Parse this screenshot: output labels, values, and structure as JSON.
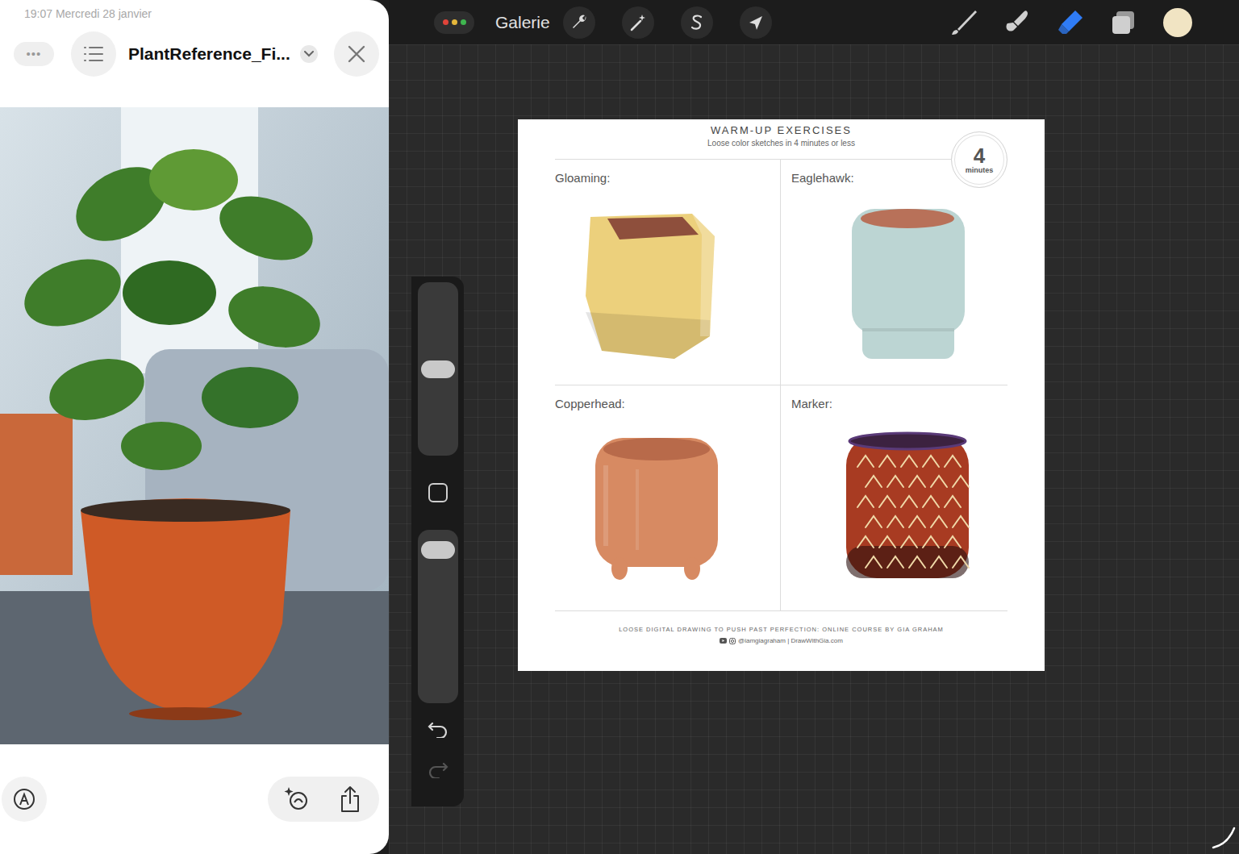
{
  "status_bar": {
    "time_date": "19:07 Mercredi 28 janvier"
  },
  "quick_look": {
    "more": "•••",
    "title": "PlantReference_Fi..."
  },
  "toolbar": {
    "gallery": "Galerie",
    "tools": [
      {
        "kind": "brush",
        "selected": false
      },
      {
        "kind": "smudge",
        "selected": false
      },
      {
        "kind": "eraser",
        "selected": true
      },
      {
        "kind": "layers",
        "selected": false
      }
    ],
    "current_color": "#f1e4c3"
  },
  "sidebar": {
    "sliders": [
      {
        "kind": "size",
        "level": 0.5
      },
      {
        "kind": "opacity",
        "level": 0.93
      }
    ],
    "undo": {
      "disabled": false
    },
    "redo": {
      "disabled": true
    }
  },
  "canvas": {
    "title": "WARM-UP EXERCISES",
    "subtitle": "Loose color sketches in 4 minutes or less",
    "badge": {
      "value": "4",
      "unit": "minutes"
    },
    "exercises": [
      {
        "label": "Gloaming:",
        "kind": "box",
        "color": "#ecd07c"
      },
      {
        "label": "Eaglehawk:",
        "kind": "cup",
        "color": "#bcd5d3"
      },
      {
        "label": "Copperhead:",
        "kind": "footed",
        "color": "#d78a62"
      },
      {
        "label": "Marker:",
        "kind": "patterned",
        "color": "#a83b22"
      }
    ],
    "footer": {
      "line": "LOOSE DIGITAL DRAWING TO PUSH PAST PERFECTION: ONLINE COURSE BY GIA GRAHAM",
      "links": "@iamgiagraham | DrawWithGia.com"
    }
  }
}
